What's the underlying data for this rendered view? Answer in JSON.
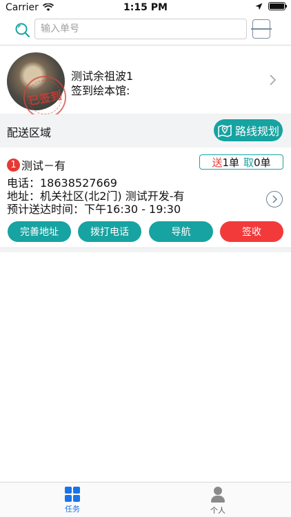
{
  "status_bar": {
    "carrier": "Carrier",
    "time": "1:15 PM"
  },
  "search": {
    "placeholder": "输入单号",
    "value": ""
  },
  "profile": {
    "name": "测试余祖波1",
    "library_label": "签到绘本馆:",
    "stamp_text": "已签到"
  },
  "area": {
    "title": "配送区域",
    "route_button": "路线规划"
  },
  "order": {
    "index": "1",
    "title": "测试－有",
    "deliver_label": "送",
    "deliver_count": "1单",
    "pickup_label": "取",
    "pickup_count": "0单",
    "phone_line": "电话：18638527669",
    "address_line": "地址：机关社区(北2门) 测试开发-有",
    "eta_line": "预计送达时间：下午16:30 - 19:30",
    "buttons": {
      "complete_address": "完善地址",
      "call": "拨打电话",
      "navigate": "导航",
      "sign": "签收"
    }
  },
  "tabbar": {
    "tasks": "任务",
    "personal": "个人"
  },
  "colors": {
    "teal": "#17a3a1",
    "red": "#f23a3a",
    "tab_active": "#1a73e8"
  }
}
